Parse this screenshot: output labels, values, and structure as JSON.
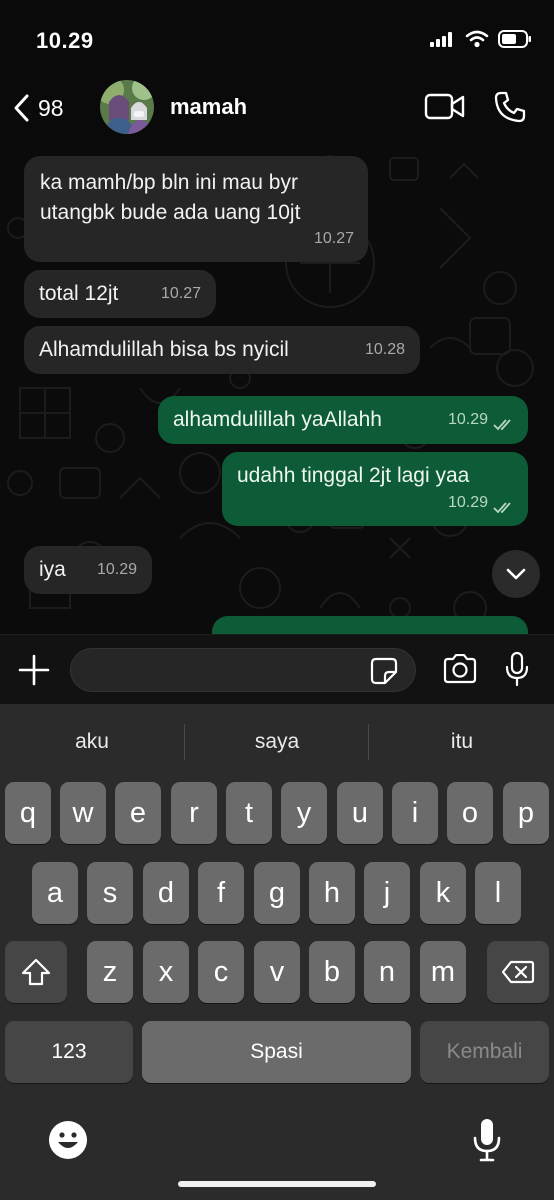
{
  "status": {
    "time": "10.29"
  },
  "header": {
    "back_count": "98",
    "contact_name": "mamah"
  },
  "messages": [
    {
      "dir": "in",
      "lines": [
        "ka mamh/bp bln ini mau byr",
        "utangbk bude ada uang 10jt"
      ],
      "time": "10.27"
    },
    {
      "dir": "in",
      "lines": [
        "total 12jt"
      ],
      "time": "10.27"
    },
    {
      "dir": "in",
      "lines": [
        "Alhamdulillah bisa bs nyicil"
      ],
      "time": "10.28"
    },
    {
      "dir": "out",
      "lines": [
        "alhamdulillah yaAllahh"
      ],
      "time": "10.29",
      "read": true
    },
    {
      "dir": "out",
      "lines": [
        "udahh tinggal 2jt lagi yaa"
      ],
      "time": "10.29",
      "read": true
    },
    {
      "dir": "in",
      "lines": [
        "iya"
      ],
      "time": "10.29"
    }
  ],
  "keyboard": {
    "suggestions": [
      "aku",
      "saya",
      "itu"
    ],
    "row1": [
      "q",
      "w",
      "e",
      "r",
      "t",
      "y",
      "u",
      "i",
      "o",
      "p"
    ],
    "row2": [
      "a",
      "s",
      "d",
      "f",
      "g",
      "h",
      "j",
      "k",
      "l"
    ],
    "row3": [
      "z",
      "x",
      "c",
      "v",
      "b",
      "n",
      "m"
    ],
    "numbers_label": "123",
    "space_label": "Spasi",
    "return_label": "Kembali"
  },
  "icons": [
    "signal-icon",
    "wifi-icon",
    "battery-icon",
    "back-chevron-icon",
    "video-call-icon",
    "phone-icon",
    "plus-icon",
    "sticker-icon",
    "camera-icon",
    "mic-icon",
    "chevron-down-icon",
    "shift-icon",
    "backspace-icon",
    "emoji-icon",
    "dictation-mic-icon"
  ],
  "colors": {
    "outgoing_bubble": "#0e5c37",
    "incoming_bubble": "#262626",
    "read_ticks": "#b8d7c3"
  }
}
